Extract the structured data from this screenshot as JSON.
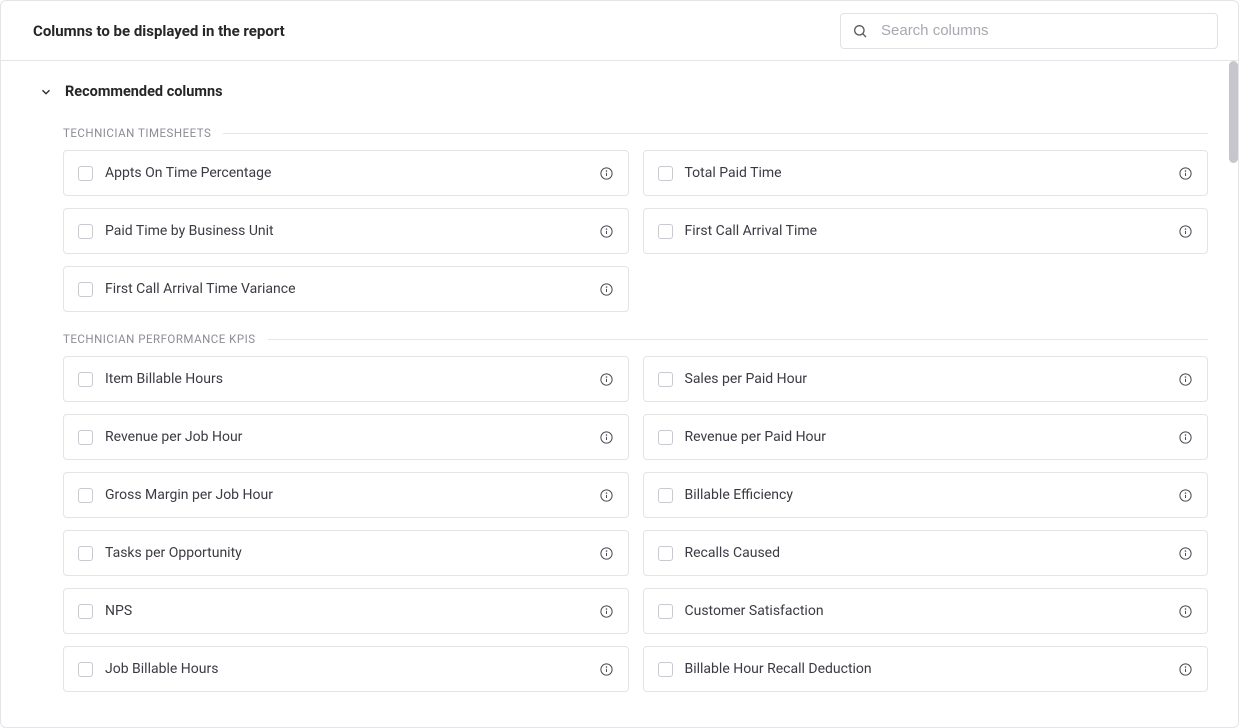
{
  "header": {
    "title": "Columns to be displayed in the report",
    "search_placeholder": "Search columns"
  },
  "section": {
    "title": "Recommended columns"
  },
  "groups": [
    {
      "label": "TECHNICIAN TIMESHEETS",
      "items": [
        {
          "label": "Appts On Time Percentage"
        },
        {
          "label": "Total Paid Time"
        },
        {
          "label": "Paid Time by Business Unit"
        },
        {
          "label": "First Call Arrival Time"
        },
        {
          "label": "First Call Arrival Time Variance"
        },
        {
          "label": ""
        }
      ]
    },
    {
      "label": "TECHNICIAN PERFORMANCE KPIS",
      "items": [
        {
          "label": "Item Billable Hours"
        },
        {
          "label": "Sales per Paid Hour"
        },
        {
          "label": "Revenue per Job Hour"
        },
        {
          "label": "Revenue per Paid Hour"
        },
        {
          "label": "Gross Margin per Job Hour"
        },
        {
          "label": "Billable Efficiency"
        },
        {
          "label": "Tasks per Opportunity"
        },
        {
          "label": "Recalls Caused"
        },
        {
          "label": "NPS"
        },
        {
          "label": "Customer Satisfaction"
        },
        {
          "label": "Job Billable Hours"
        },
        {
          "label": "Billable Hour Recall Deduction"
        }
      ]
    }
  ]
}
